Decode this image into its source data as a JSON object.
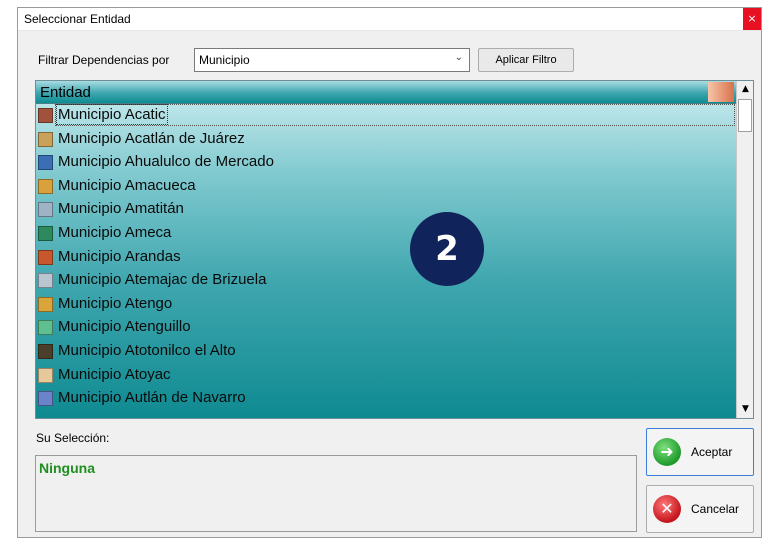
{
  "window": {
    "title": "Seleccionar Entidad",
    "close_glyph": "×"
  },
  "filter": {
    "label": "Filtrar Dependencias por",
    "value": "Municipio",
    "arrow_glyph": "⌄",
    "apply_label": "Aplicar Filtro"
  },
  "grid": {
    "column_header": "Entidad",
    "rows": [
      {
        "label": "Municipio Acatic",
        "icon": "municipality-emblem-icon",
        "icon_color": "#a0523d"
      },
      {
        "label": "Municipio Acatlán de Juárez",
        "icon": "municipality-emblem-icon",
        "icon_color": "#c9a15a"
      },
      {
        "label": "Municipio Ahualulco de Mercado",
        "icon": "municipality-emblem-icon",
        "icon_color": "#3a6fb5"
      },
      {
        "label": "Municipio Amacueca",
        "icon": "municipality-emblem-icon",
        "icon_color": "#d8a13c"
      },
      {
        "label": "Municipio Amatitán",
        "icon": "municipality-emblem-icon",
        "icon_color": "#9fb3c7"
      },
      {
        "label": "Municipio Ameca",
        "icon": "municipality-emblem-icon",
        "icon_color": "#2c8a5e"
      },
      {
        "label": "Municipio Arandas",
        "icon": "municipality-emblem-icon",
        "icon_color": "#c8572c"
      },
      {
        "label": "Municipio Atemajac de Brizuela",
        "icon": "municipality-emblem-icon",
        "icon_color": "#b9c6d2"
      },
      {
        "label": "Municipio Atengo",
        "icon": "municipality-emblem-icon",
        "icon_color": "#d9a43a"
      },
      {
        "label": "Municipio Atenguillo",
        "icon": "municipality-emblem-icon",
        "icon_color": "#5fbf8e"
      },
      {
        "label": "Municipio Atotonilco el Alto",
        "icon": "municipality-emblem-icon",
        "icon_color": "#4a3f2a"
      },
      {
        "label": "Municipio Atoyac",
        "icon": "municipality-emblem-icon",
        "icon_color": "#e6c89a"
      },
      {
        "label": "Municipio Autlán de Navarro",
        "icon": "municipality-emblem-icon",
        "icon_color": "#6b83c9"
      }
    ],
    "scroll_up_glyph": "▲",
    "scroll_down_glyph": "▼"
  },
  "overlay_badge": {
    "text": "2"
  },
  "selection": {
    "label": "Su Selección:",
    "value": "Ninguna"
  },
  "buttons": {
    "accept": {
      "label": "Aceptar",
      "icon_glyph": "➜"
    },
    "cancel": {
      "label": "Cancelar",
      "icon_glyph": "✕"
    }
  }
}
